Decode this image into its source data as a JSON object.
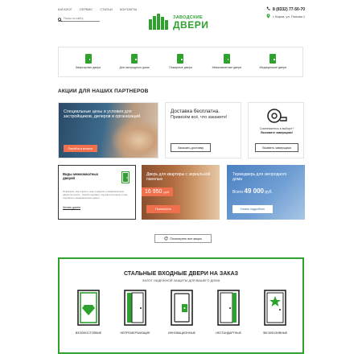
{
  "header": {
    "nav": [
      "Каталог",
      "Сервис",
      "Статьи",
      "Контакты"
    ],
    "search_placeholder": "Поиск по сайту",
    "logo_small": "ЗАВОДСКИЕ",
    "logo_big": "ДВЕРИ",
    "phone": "8 (8332) 77-50-70",
    "address": "г. Киров, ул. Попова 1"
  },
  "categories": [
    {
      "label": "Квартирные двери"
    },
    {
      "label": "Для загородного дома"
    },
    {
      "label": "Пожарные двери"
    },
    {
      "label": "Межкомнатные двери"
    },
    {
      "label": "Медицинские двери"
    }
  ],
  "section_title": "Акции для наших партнеров",
  "promo1": {
    "text": "Специальные цены и условия для застройщиков, дилеров и организаций",
    "button": "Перейти в каталог"
  },
  "promo2": {
    "title": "Доставка бесплатна.",
    "text": "Привезём всё, что закажете!",
    "button": "Заказать доставку"
  },
  "promo3": {
    "question": "Сомневаетесь в выборе?",
    "emph": "Вызовите замерщика!",
    "button": "Вызвать замерщика"
  },
  "promo4": {
    "title": "Виды межкомнатных дверей",
    "body": "Помогаем, как открыть окно в дверях и межкомнатные двери металла... Какой подойдет под ваш интерьер и как подобрать межкомнатные двери.",
    "link": "Читать далее"
  },
  "promo5": {
    "text": "Дверь для квартиры с зеркальной панелью",
    "price": "16 950",
    "currency": "руб.",
    "button": "Посмотреть"
  },
  "promo6": {
    "text": "Термодверь для загородного дома",
    "price_prefix": "Всего",
    "price": "49 000",
    "currency": "руб.",
    "button": "Узнать подробнее"
  },
  "see_all": "Посмотреть все акции",
  "features": {
    "title": "Стальные входные двери на заказ",
    "subtitle": "Залог надежной защиты для вашего дома",
    "items": [
      {
        "label": "Взломостойкие"
      },
      {
        "label": "Непромерзающие"
      },
      {
        "label": "Инновационные"
      },
      {
        "label": "Нестандартные"
      },
      {
        "label": "Эксклюзивные"
      }
    ]
  },
  "colors": {
    "accent": "#2ea12e",
    "orange": "#f0704e",
    "blue": "#4a7fc0"
  }
}
